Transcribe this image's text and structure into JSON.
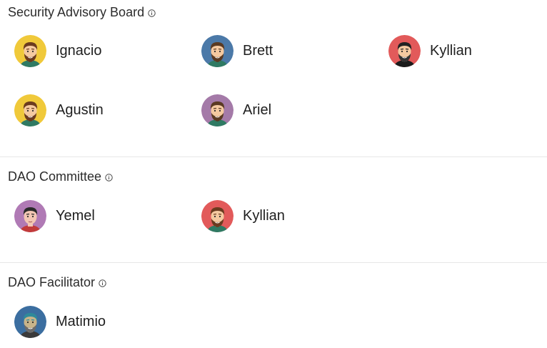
{
  "sections": [
    {
      "title": "Security Advisory Board",
      "info_icon": "info-circle-icon",
      "members": [
        {
          "name": "Ignacio",
          "avatar_bg": "#f0c93a",
          "skin": "#f4c9a0",
          "hair": "#6b3b1f",
          "beard": "#6b3b1f",
          "shirt": "#2f7a63"
        },
        {
          "name": "Brett",
          "avatar_bg": "#4b79a8",
          "skin": "#f4c9a0",
          "hair": "#5a3a22",
          "beard": "#5a3a22",
          "shirt": "#2f7a63"
        },
        {
          "name": "Kyllian",
          "avatar_bg": "#e25a5a",
          "skin": "#f4c9a0",
          "hair": "#222222",
          "beard": "#333333",
          "shirt": "#1b1b1b"
        },
        {
          "name": "Agustin",
          "avatar_bg": "#f0c93a",
          "skin": "#f4c9a0",
          "hair": "#6b3b1f",
          "beard": "#6b3b1f",
          "shirt": "#2f7a63"
        },
        {
          "name": "Ariel",
          "avatar_bg": "#a47aa8",
          "skin": "#f4c9a0",
          "hair": "#5a3a22",
          "beard": "#5a3a22",
          "shirt": "#2f7a63"
        }
      ]
    },
    {
      "title": "DAO Committee",
      "info_icon": "info-circle-icon",
      "members": [
        {
          "name": "Yemel",
          "avatar_bg": "#b07ab5",
          "skin": "#f3c7b4",
          "hair": "#2a2a2a",
          "beard": "none",
          "shirt": "#c23b3b"
        },
        {
          "name": "Kyllian",
          "avatar_bg": "#e25a5a",
          "skin": "#f4c9a0",
          "hair": "#6b3b1f",
          "beard": "#6b3b1f",
          "shirt": "#2f7a63"
        }
      ]
    },
    {
      "title": "DAO Facilitator",
      "info_icon": "info-circle-icon",
      "members": [
        {
          "name": "Matimio",
          "avatar_bg": "#3b6ea0",
          "skin": "#c8b48a",
          "hair": "#2f8a9a",
          "beard": "#6b6b6b",
          "shirt": "#3a3a3a"
        }
      ]
    }
  ]
}
